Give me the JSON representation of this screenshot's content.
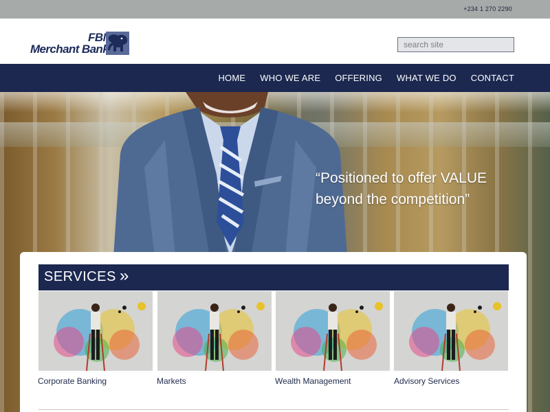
{
  "topbar": {
    "phone": "+234 1 270 2290"
  },
  "logo": {
    "line1": "FBN",
    "line2": "Merchant Bank"
  },
  "search": {
    "placeholder": "search site"
  },
  "nav": {
    "items": [
      "HOME",
      "WHO WE ARE",
      "OFFERING",
      "WHAT WE DO",
      "CONTACT"
    ]
  },
  "hero": {
    "quote_line1": "“Positioned to offer VALUE",
    "quote_line2": "beyond the competition”"
  },
  "services": {
    "title": "SERVICES",
    "chevron": "»",
    "items": [
      {
        "label": "Corporate Banking"
      },
      {
        "label": "Markets"
      },
      {
        "label": "Wealth Management"
      },
      {
        "label": "Advisory Services"
      }
    ]
  },
  "colors": {
    "navy": "#1c2850",
    "topbar": "#a6aaa8",
    "logo": "#1c2b5a"
  }
}
